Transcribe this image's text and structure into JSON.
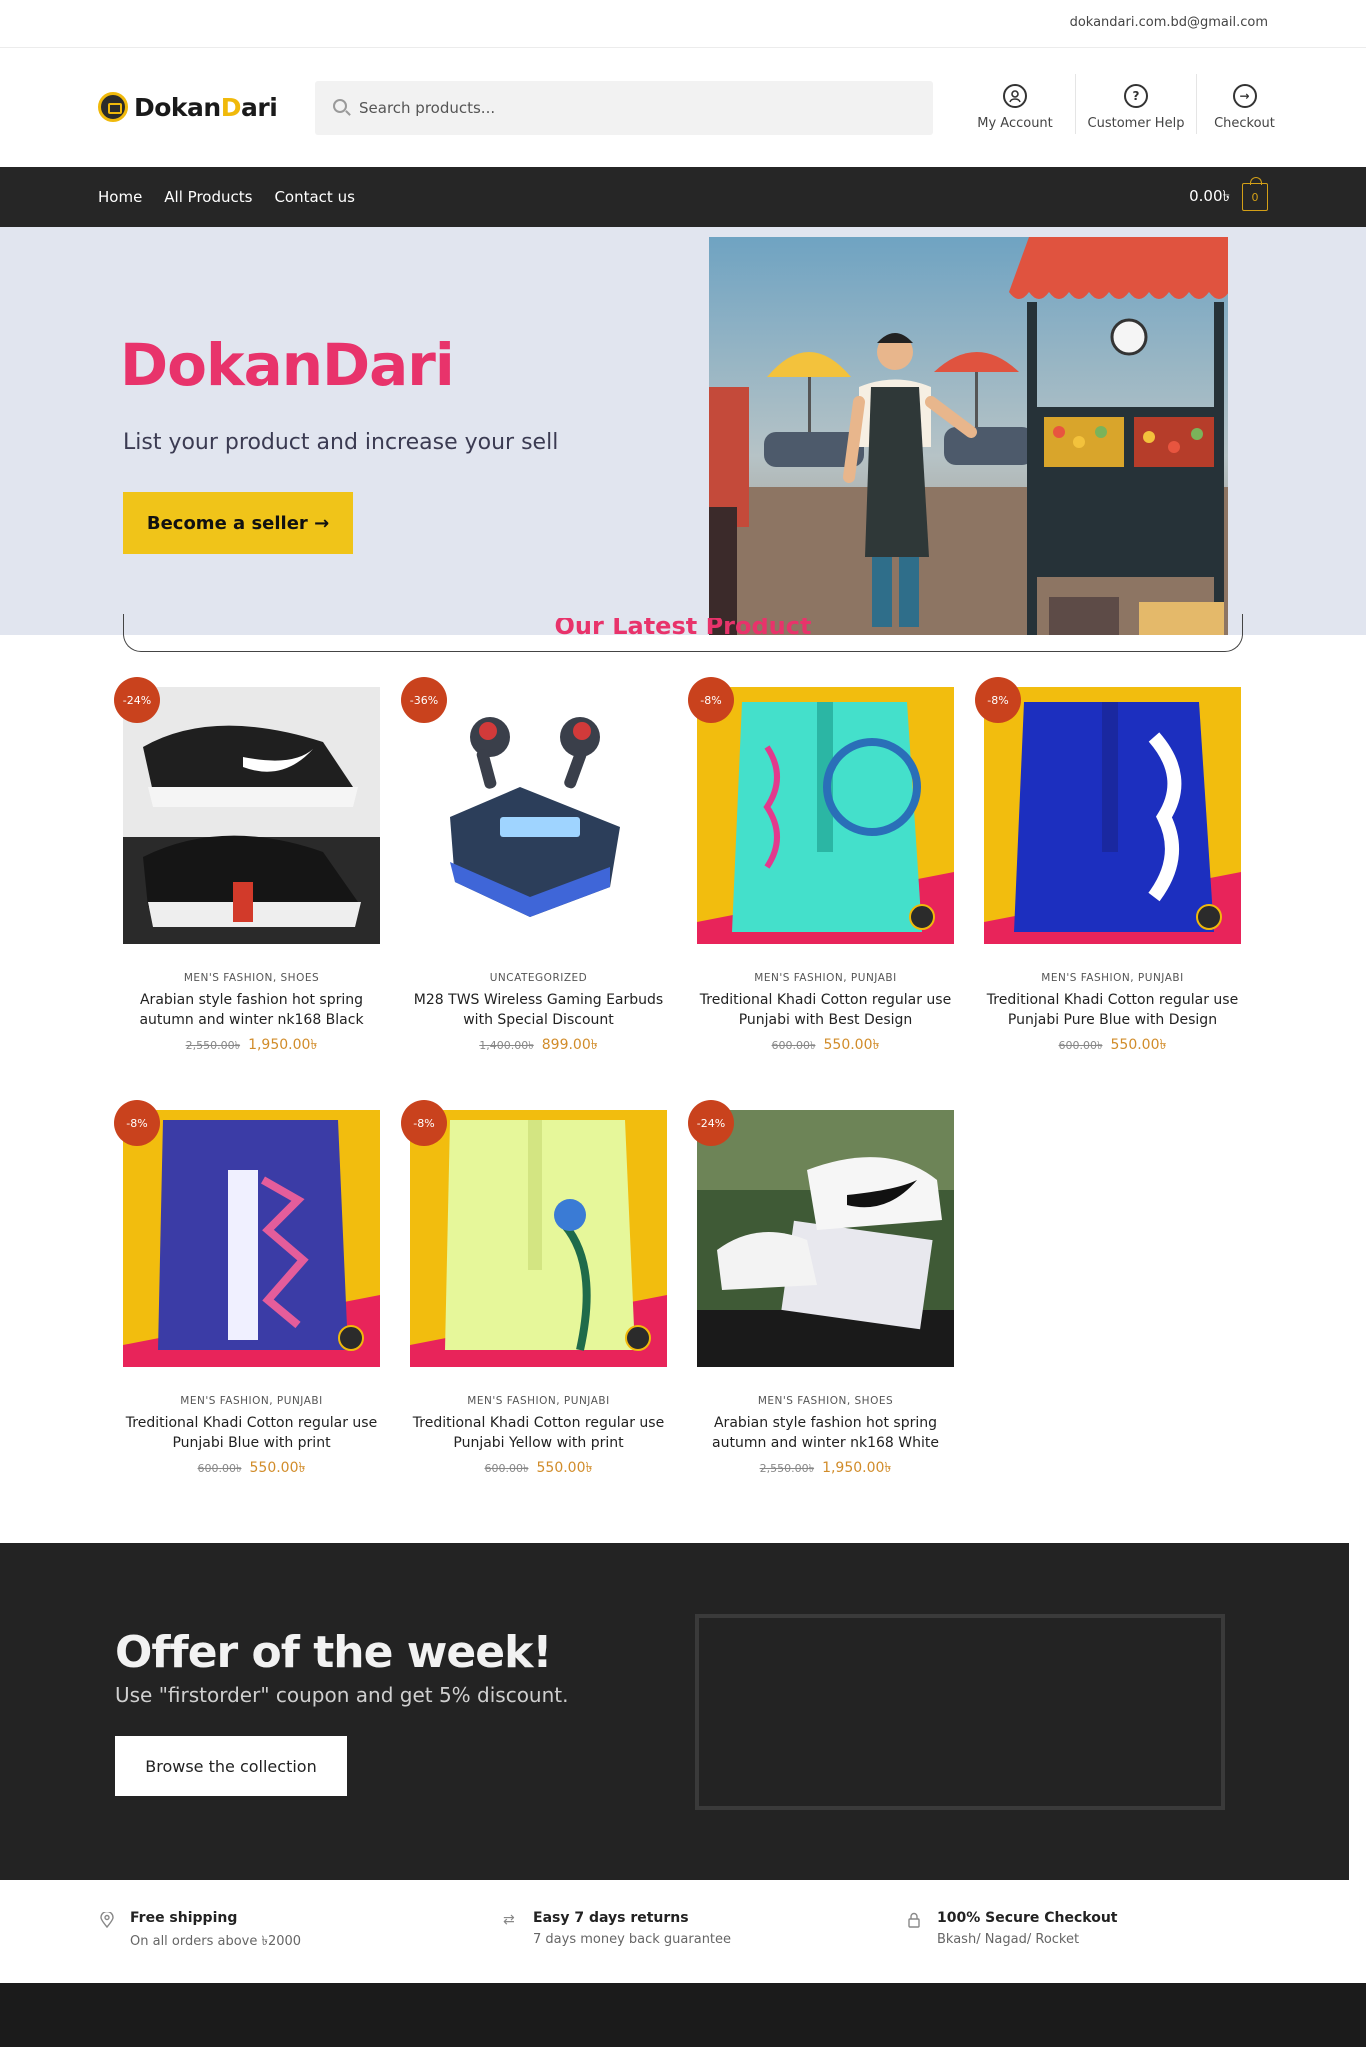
{
  "topbar": {
    "email": "dokandari.com.bd@gmail.com"
  },
  "header": {
    "logo": {
      "part1": "Dokan",
      "part2": "D",
      "part3": "ari"
    },
    "search_placeholder": "Search products...",
    "links": [
      {
        "label": "My Account",
        "icon": "user-icon"
      },
      {
        "label": "Customer Help",
        "icon": "question-icon"
      },
      {
        "label": "Checkout",
        "icon": "arrow-right-icon"
      }
    ]
  },
  "nav": {
    "items": [
      "Home",
      "All Products",
      "Contact us"
    ],
    "cart_amount": "0.00৳",
    "cart_count": "0"
  },
  "hero": {
    "title": "DokanDari",
    "subtitle": "List your product and increase your sell",
    "button": "Become a seller →"
  },
  "latest": {
    "title": "Our Latest Product"
  },
  "products": [
    {
      "badge": "-24%",
      "category": "MEN'S FASHION, SHOES",
      "name": "Arabian style fashion hot spring autumn and winter nk168 Black",
      "old_price": "2,550.00৳",
      "price": "1,950.00৳"
    },
    {
      "badge": "-36%",
      "category": "UNCATEGORIZED",
      "name": "M28 TWS Wireless Gaming Earbuds with Special Discount",
      "old_price": "1,400.00৳",
      "price": "899.00৳"
    },
    {
      "badge": "-8%",
      "category": "MEN'S FASHION, PUNJABI",
      "name": "Treditional Khadi Cotton regular use Punjabi with Best Design",
      "old_price": "600.00৳",
      "price": "550.00৳"
    },
    {
      "badge": "-8%",
      "category": "MEN'S FASHION, PUNJABI",
      "name": "Treditional Khadi Cotton regular use Punjabi Pure Blue with Design",
      "old_price": "600.00৳",
      "price": "550.00৳"
    },
    {
      "badge": "-8%",
      "category": "MEN'S FASHION, PUNJABI",
      "name": "Treditional Khadi Cotton regular use Punjabi Blue with print",
      "old_price": "600.00৳",
      "price": "550.00৳"
    },
    {
      "badge": "-8%",
      "category": "MEN'S FASHION, PUNJABI",
      "name": "Treditional Khadi Cotton regular use Punjabi Yellow with print",
      "old_price": "600.00৳",
      "price": "550.00৳"
    },
    {
      "badge": "-24%",
      "category": "MEN'S FASHION, SHOES",
      "name": "Arabian style fashion hot spring autumn and winter nk168 White",
      "old_price": "2,550.00৳",
      "price": "1,950.00৳"
    }
  ],
  "offer": {
    "title": "Offer of the week!",
    "subtitle": "Use \"firstorder\" coupon and get 5% discount.",
    "button": "Browse the collection"
  },
  "features": [
    {
      "title": "Free shipping",
      "desc": "On all orders above ৳2000",
      "icon": "location-pin-icon"
    },
    {
      "title": "Easy 7 days returns",
      "desc": "7 days money back guarantee",
      "icon": "swap-arrows-icon"
    },
    {
      "title": "100% Secure Checkout",
      "desc": "Bkash/ Nagad/ Rocket",
      "icon": "lock-icon"
    }
  ],
  "colors": {
    "brand_pink": "#e8336b",
    "brand_yellow": "#f0c419",
    "sale_badge": "#c9421d",
    "price": "#d18c2a",
    "nav_bg": "#262626"
  }
}
